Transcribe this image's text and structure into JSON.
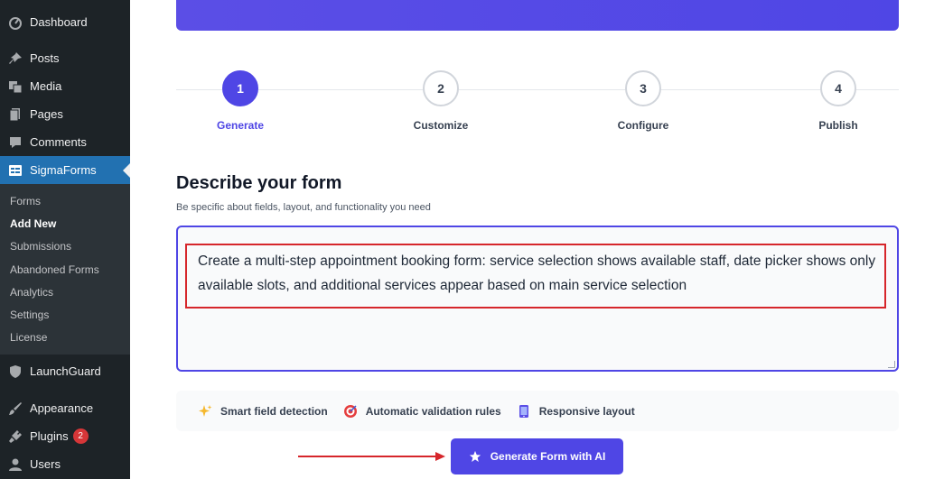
{
  "sidebar": {
    "items": [
      {
        "label": "Dashboard",
        "icon": "dashboard-icon"
      },
      {
        "label": "Posts",
        "icon": "pin-icon"
      },
      {
        "label": "Media",
        "icon": "media-icon"
      },
      {
        "label": "Pages",
        "icon": "pages-icon"
      },
      {
        "label": "Comments",
        "icon": "comment-icon"
      },
      {
        "label": "SigmaForms",
        "icon": "form-icon"
      }
    ],
    "submenu": [
      "Forms",
      "Add New",
      "Submissions",
      "Abandoned Forms",
      "Analytics",
      "Settings",
      "License"
    ],
    "items_after": [
      {
        "label": "LaunchGuard",
        "icon": "shield-icon"
      },
      {
        "label": "Appearance",
        "icon": "brush-icon"
      },
      {
        "label": "Plugins",
        "icon": "plug-icon",
        "badge": "2"
      },
      {
        "label": "Users",
        "icon": "user-icon"
      }
    ]
  },
  "stepper": {
    "steps": [
      {
        "number": "1",
        "label": "Generate"
      },
      {
        "number": "2",
        "label": "Customize"
      },
      {
        "number": "3",
        "label": "Configure"
      },
      {
        "number": "4",
        "label": "Publish"
      }
    ]
  },
  "form": {
    "title": "Describe your form",
    "subtitle": "Be specific about fields, layout, and functionality you need",
    "prompt": "Create a multi-step appointment booking form: service selection shows available staff, date picker shows only available slots, and additional services appear based on main service selection"
  },
  "features": [
    {
      "label": "Smart field detection",
      "icon": "sparkle-icon"
    },
    {
      "label": "Automatic validation rules",
      "icon": "target-icon"
    },
    {
      "label": "Responsive layout",
      "icon": "mobile-icon"
    }
  ],
  "generate_button": {
    "label": "Generate Form with AI",
    "icon": "star-icon"
  },
  "colors": {
    "accent": "#4f46e5",
    "sidebar": "#1d2327",
    "active_menu": "#2271b1",
    "highlight": "#d6262b"
  }
}
